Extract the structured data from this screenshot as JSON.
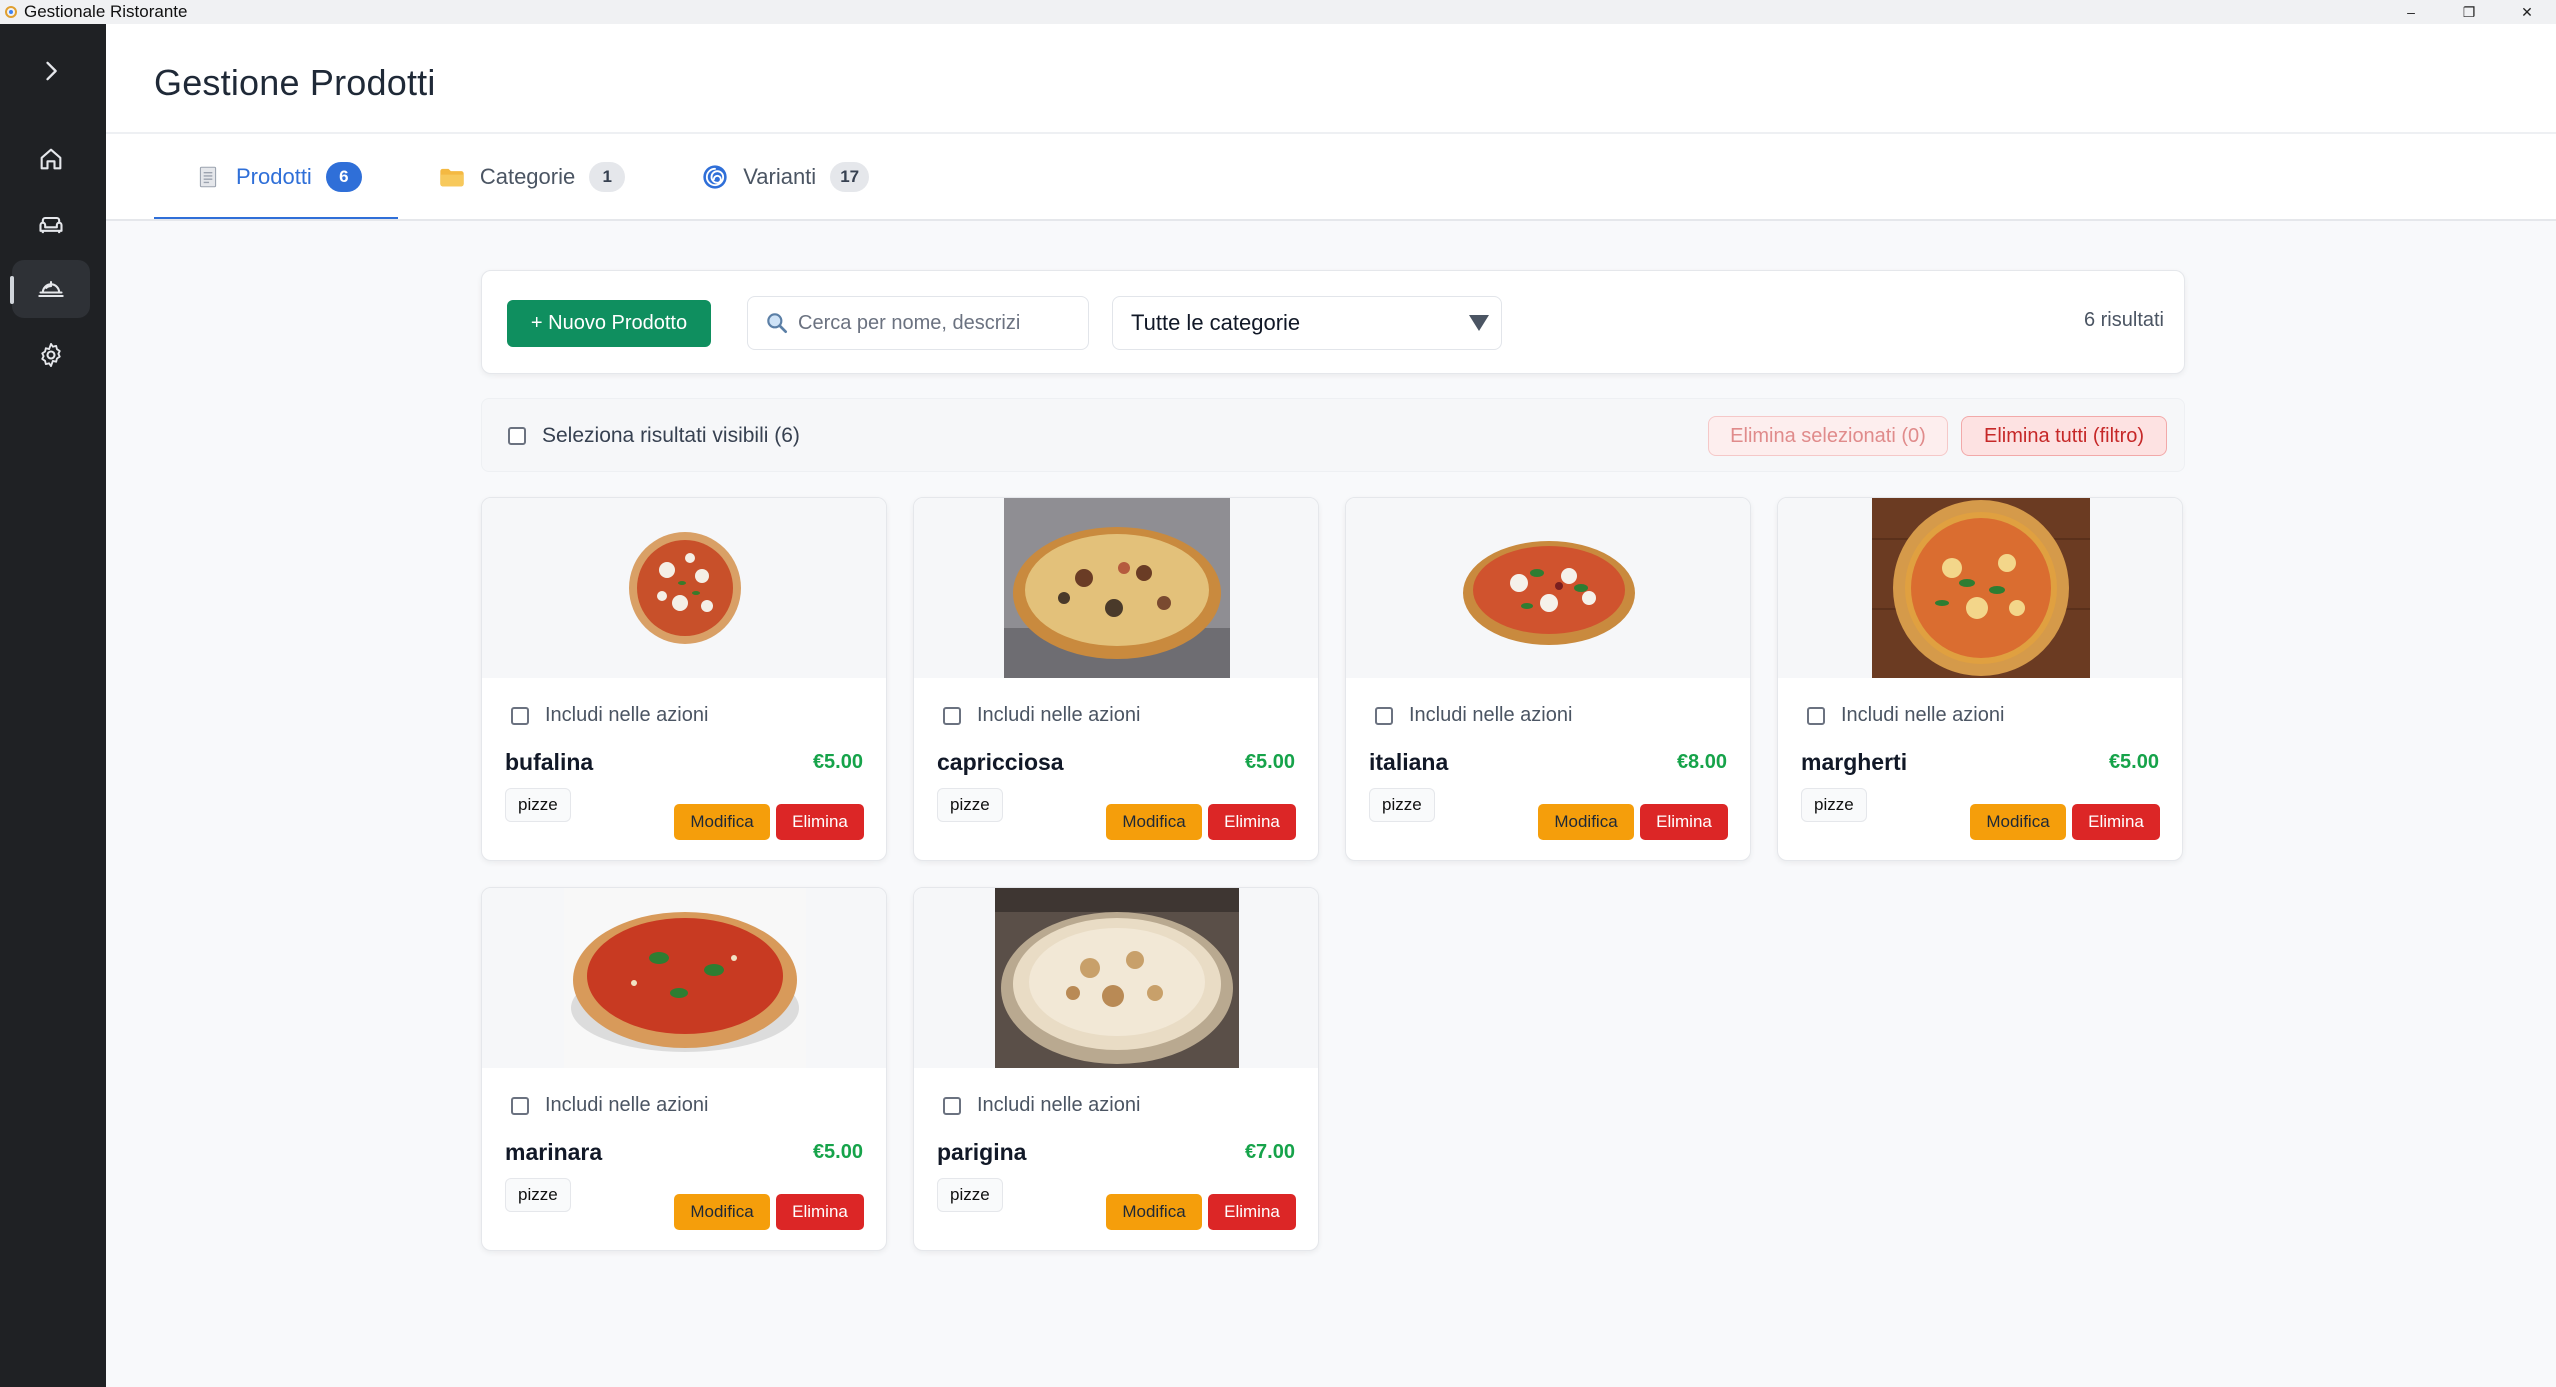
{
  "window": {
    "title": "Gestionale Ristorante",
    "controls": [
      "–",
      "❐",
      "✕"
    ]
  },
  "sidebar": {
    "items": [
      {
        "icon": "chevron-right-icon",
        "active": false
      },
      {
        "icon": "home-icon",
        "active": false
      },
      {
        "icon": "sofa-icon",
        "active": false
      },
      {
        "icon": "dish-icon",
        "active": true
      },
      {
        "icon": "gear-icon",
        "active": false
      }
    ]
  },
  "header": {
    "title": "Gestione Prodotti"
  },
  "tabs": [
    {
      "label": "Prodotti",
      "count": "6",
      "icon": "document-icon",
      "active": true
    },
    {
      "label": "Categorie",
      "count": "1",
      "icon": "folder-icon",
      "active": false
    },
    {
      "label": "Varianti",
      "count": "17",
      "icon": "swirl-icon",
      "active": false
    }
  ],
  "toolbar": {
    "new_label": "+ Nuovo Prodotto",
    "search_placeholder": "Cerca per nome, descrizi",
    "category_selected": "Tutte le categorie",
    "results": "6 risultati"
  },
  "selection": {
    "select_visible_label": "Seleziona risultati visibili (6)",
    "delete_selected_label": "Elimina selezionati (0)",
    "delete_all_label": "Elimina tutti (filtro)"
  },
  "product_labels": {
    "include": "Includi nelle azioni",
    "edit": "Modifica",
    "delete": "Elimina"
  },
  "products": [
    {
      "name": "bufalina",
      "price": "€5.00",
      "tag": "pizze"
    },
    {
      "name": "capricciosa",
      "price": "€5.00",
      "tag": "pizze"
    },
    {
      "name": "italiana",
      "price": "€8.00",
      "tag": "pizze"
    },
    {
      "name": "margherti",
      "price": "€5.00",
      "tag": "pizze"
    },
    {
      "name": "marinara",
      "price": "€5.00",
      "tag": "pizze"
    },
    {
      "name": "parigina",
      "price": "€7.00",
      "tag": "pizze"
    }
  ],
  "colors": {
    "accent": "#2f6fd8",
    "primary_button": "#0f8f5f",
    "edit_button": "#f59e0b",
    "delete_button": "#dc2626",
    "price": "#16a34a",
    "sidebar": "#1f2124"
  }
}
